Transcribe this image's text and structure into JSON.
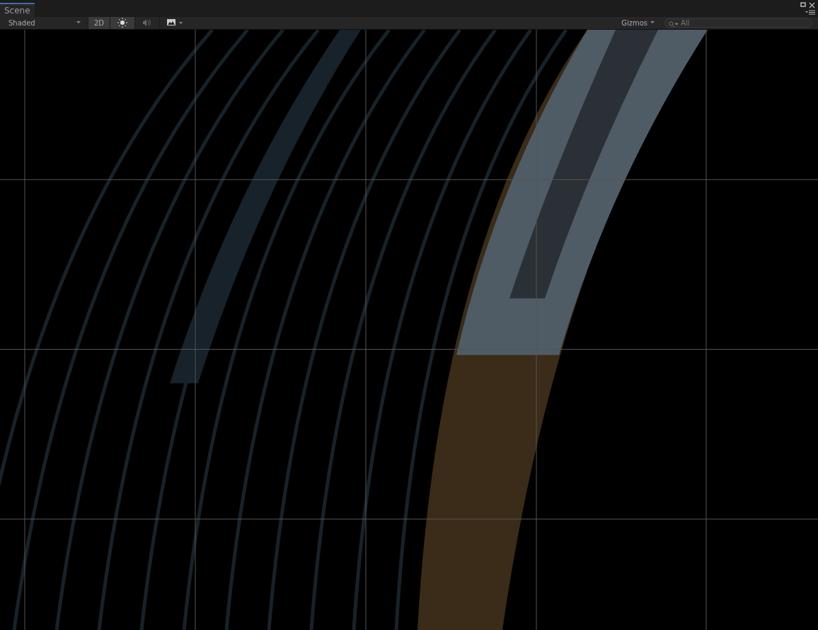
{
  "tab": {
    "label": "Scene",
    "selected": true
  },
  "toolbar": {
    "draw_mode": "Shaded",
    "mode_2d": {
      "label": "2D",
      "on": true
    },
    "lighting": {
      "on": true
    },
    "audio": {
      "on": false
    },
    "effects": {
      "on": false
    },
    "gizmos": "Gizmos",
    "search": {
      "placeholder": "All"
    }
  }
}
